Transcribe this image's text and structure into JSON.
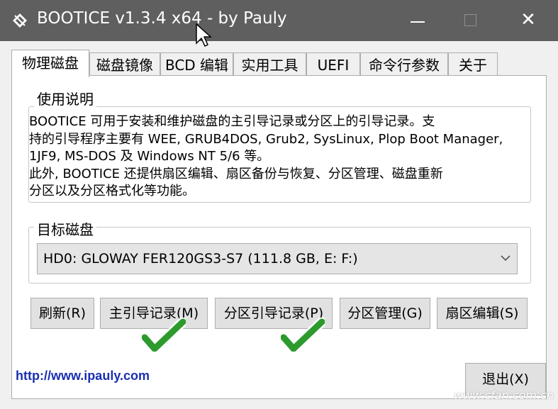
{
  "window": {
    "title": "BOOTICE v1.3.4 x64 - by Pauly",
    "minimize_label": "",
    "maximize_label": "",
    "close_label": "✕"
  },
  "tabs": [
    {
      "label": "物理磁盘"
    },
    {
      "label": "磁盘镜像"
    },
    {
      "label": "BCD 编辑"
    },
    {
      "label": "实用工具"
    },
    {
      "label": "UEFI"
    },
    {
      "label": "命令行参数"
    },
    {
      "label": "关于"
    }
  ],
  "usage": {
    "group_label": "使用说明",
    "lines": [
      "BOOTICE 可用于安装和维护磁盘的主引导记录或分区上的引导记录。支",
      "持的引导程序主要有 WEE, GRUB4DOS, Grub2, SysLinux, Plop Boot Manager,",
      "1JF9, MS-DOS 及 Windows NT 5/6 等。",
      "此外, BOOTICE 还提供扇区编辑、扇区备份与恢复、分区管理、磁盘重新",
      "分区以及分区格式化等功能。"
    ]
  },
  "target_disk": {
    "group_label": "目标磁盘",
    "selected": "HD0: GLOWAY FER120GS3-S7 (111.8 GB, E: F:)"
  },
  "buttons": {
    "refresh": "刷新(R)",
    "mbr": "主引导记录(M)",
    "pbr": "分区引导记录(P)",
    "parts": "分区管理(G)",
    "sector": "扇区编辑(S)",
    "exit": "退出(X)"
  },
  "footer": {
    "url": "http://www.ipauly.com",
    "watermark": "www.cfan.com.cn"
  },
  "colors": {
    "titlebar": "#5f5f5f",
    "check_green": "#2d9a2d",
    "url_blue": "#1a2fb0"
  }
}
